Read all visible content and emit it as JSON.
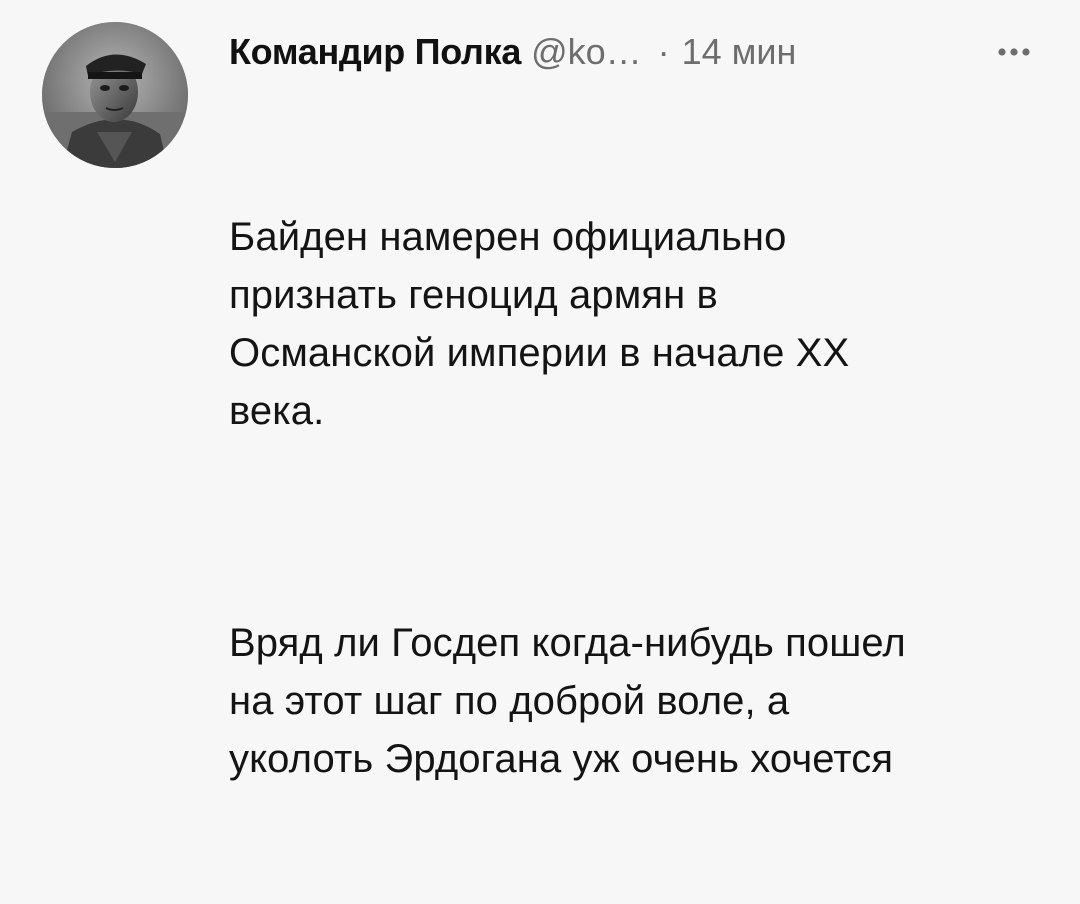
{
  "tweet": {
    "author": {
      "display_name": "Командир Полка",
      "handle": "@ko…"
    },
    "separator": "·",
    "time": "14 мин",
    "more_icon": "more-horizontal-icon",
    "paragraphs": [
      "Байден намерен официально\nпризнать геноцид армян в\nОсманской империи в начале XX\nвека.",
      "Вряд ли Госдеп когда-нибудь пошел\nна этот шаг по доброй воле, а\nуколоть Эрдогана уж очень хочется"
    ]
  },
  "colors": {
    "background": "#f7f7f7",
    "text": "#141414",
    "secondary_text": "#6e6e6e"
  }
}
